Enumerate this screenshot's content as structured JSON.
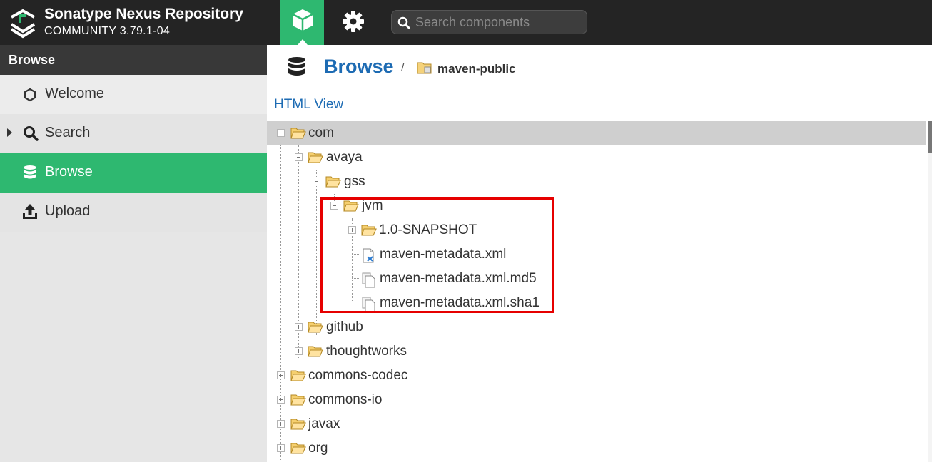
{
  "header": {
    "brand_name": "Sonatype Nexus Repository",
    "brand_version": "COMMUNITY 3.79.1-04",
    "search_placeholder": "Search components",
    "accent_color": "#2eb870"
  },
  "sidebar": {
    "title": "Browse",
    "items": [
      {
        "label": "Welcome",
        "icon": "hexagon-icon"
      },
      {
        "label": "Search",
        "icon": "search-icon"
      },
      {
        "label": "Browse",
        "icon": "database-icon",
        "active": true
      },
      {
        "label": "Upload",
        "icon": "upload-icon"
      }
    ]
  },
  "main": {
    "title": "Browse",
    "breadcrumb_separator": "/",
    "repository": "maven-public",
    "html_view_link": "HTML View"
  },
  "tree": [
    {
      "name": "com",
      "type": "folder",
      "expanded": true,
      "selected": true
    },
    {
      "name": "avaya",
      "type": "folder",
      "expanded": true
    },
    {
      "name": "gss",
      "type": "folder",
      "expanded": true
    },
    {
      "name": "jvm",
      "type": "folder",
      "expanded": true
    },
    {
      "name": "1.0-SNAPSHOT",
      "type": "folder",
      "expanded": false
    },
    {
      "name": "maven-metadata.xml",
      "type": "xml-file"
    },
    {
      "name": "maven-metadata.xml.md5",
      "type": "file"
    },
    {
      "name": "maven-metadata.xml.sha1",
      "type": "file"
    },
    {
      "name": "github",
      "type": "folder",
      "expanded": false
    },
    {
      "name": "thoughtworks",
      "type": "folder",
      "expanded": false
    },
    {
      "name": "commons-codec",
      "type": "folder",
      "expanded": false
    },
    {
      "name": "commons-io",
      "type": "folder",
      "expanded": false
    },
    {
      "name": "javax",
      "type": "folder",
      "expanded": false
    },
    {
      "name": "org",
      "type": "folder",
      "expanded": false
    }
  ],
  "highlight_color": "#e60000"
}
